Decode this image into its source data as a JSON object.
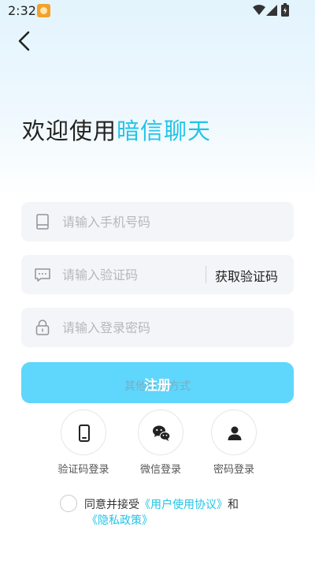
{
  "status_bar": {
    "time": "2:32"
  },
  "title": {
    "prefix": "欢迎使用",
    "brand": "暗信聊天"
  },
  "form": {
    "phone_placeholder": "请输入手机号码",
    "code_placeholder": "请输入验证码",
    "get_code_label": "获取验证码",
    "password_placeholder": "请输入登录密码"
  },
  "login_button": {
    "label": "注册",
    "overlay_label": "其他登录方式"
  },
  "alt_logins": [
    {
      "label": "验证码登录",
      "icon": "phone-icon"
    },
    {
      "label": "微信登录",
      "icon": "wechat-icon"
    },
    {
      "label": "密码登录",
      "icon": "person-icon"
    }
  ],
  "agreement": {
    "text_prefix": "同意并接受",
    "user_agreement": "《用户使用协议》",
    "and": "和",
    "privacy_policy": "《隐私政策》"
  },
  "colors": {
    "accent": "#22c4e8",
    "button": "#5fd6fb",
    "field_bg": "#f4f5f8"
  }
}
